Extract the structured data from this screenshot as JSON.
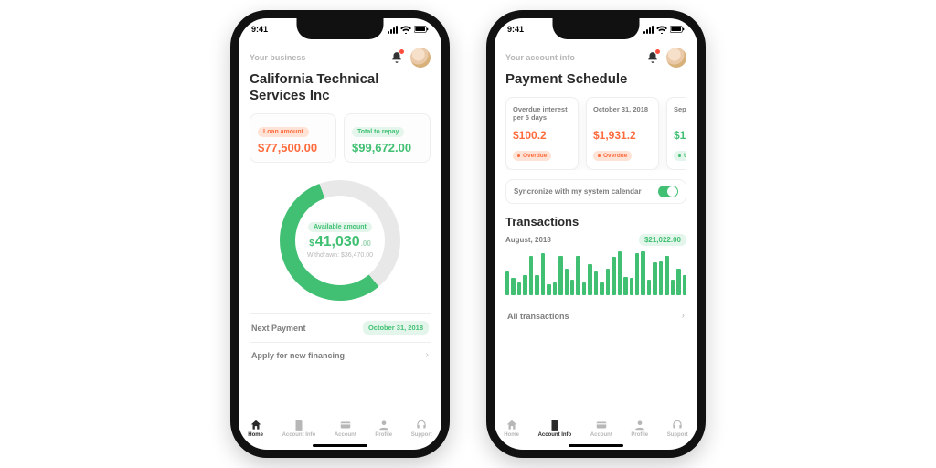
{
  "status_time": "9:41",
  "left": {
    "eyebrow": "Your business",
    "title": "California Technical Services Inc",
    "loan": {
      "label": "Loan amount",
      "value": "$77,500.00"
    },
    "repay": {
      "label": "Total to repay",
      "value": "$99,672.00"
    },
    "available": {
      "label": "Available amount",
      "currency": "$",
      "whole": "41,030",
      "cents": ".00"
    },
    "withdrawn": "Withdrawn: $36,470.00",
    "next_payment": {
      "label": "Next Payment",
      "date": "October 31, 2018"
    },
    "apply": "Apply for new financing",
    "tabs": [
      "Home",
      "Account Info",
      "Account",
      "Profile",
      "Support"
    ],
    "active_tab": 0
  },
  "right": {
    "eyebrow": "Your account info",
    "title": "Payment Schedule",
    "schedule": [
      {
        "title": "Overdue interest per 5 days",
        "amount": "$100.2",
        "status": "Overdue",
        "tone": "orange"
      },
      {
        "title": "October 31, 2018",
        "amount": "$1,931.2",
        "status": "Overdue",
        "tone": "orange"
      },
      {
        "title": "Sept",
        "amount": "$1",
        "status": "U",
        "tone": "green"
      }
    ],
    "sync": "Syncronize with my system calendar",
    "tx_heading": "Transactions",
    "tx_month": "August, 2018",
    "tx_total": "$21,022.00",
    "all_tx": "All transactions",
    "tabs": [
      "Home",
      "Account Info",
      "Account",
      "Profile",
      "Support"
    ],
    "active_tab": 1
  },
  "chart_data": {
    "type": "bar",
    "title": "Transactions — August, 2018",
    "total": 21022.0,
    "categories_note": "Daily bars for August 2018; exact values not labeled, heights are relative estimates 0–100",
    "values": [
      55,
      40,
      30,
      45,
      90,
      45,
      95,
      25,
      30,
      90,
      60,
      35,
      90,
      30,
      70,
      55,
      30,
      60,
      88,
      100,
      42,
      40,
      95,
      100,
      35,
      75,
      78,
      90,
      35,
      60,
      45
    ]
  }
}
